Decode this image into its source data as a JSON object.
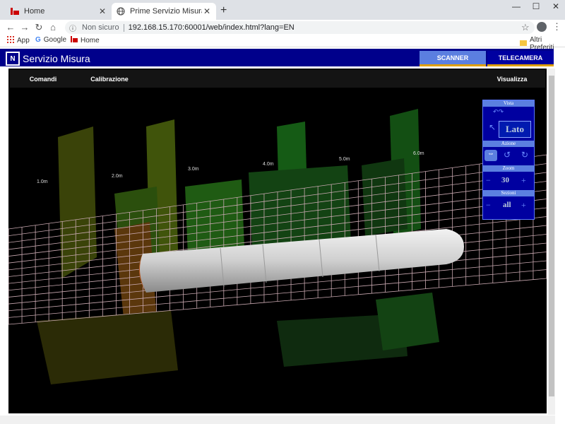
{
  "browser": {
    "tabs": [
      {
        "title": "Home",
        "active": false
      },
      {
        "title": "Prime Servizio Misura",
        "active": true
      }
    ],
    "address": {
      "security": "Non sicuro",
      "url": "192.168.15.170:60001/web/index.html?lang=EN"
    },
    "bookmarks": [
      {
        "label": "App",
        "icon": "apps-grid-icon"
      },
      {
        "label": "Google",
        "icon": "google-icon"
      },
      {
        "label": "Home",
        "icon": "home-bookmark-icon"
      }
    ],
    "other_bookmarks": "Altri Preferiti"
  },
  "app": {
    "title": "Servizio Misura",
    "header_buttons": {
      "scanner": "SCANNER",
      "telecamera": "TELECAMERA"
    },
    "subtabs": {
      "comandi": "Comandi",
      "calibrazione": "Calibrazione",
      "visualizza": "Visualizza"
    },
    "distance_labels": [
      "1.0m",
      "2.0m",
      "3.0m",
      "4.0m",
      "5.0m",
      "6.0m"
    ],
    "panel": {
      "vista_label": "Vista",
      "view_value": "Lato",
      "azione_label": "Azione",
      "zoom_label": "Zoom",
      "zoom_value": "30",
      "sezioni_label": "Sezioni",
      "sezioni_value": "all",
      "minus": "−",
      "plus": "+"
    }
  }
}
